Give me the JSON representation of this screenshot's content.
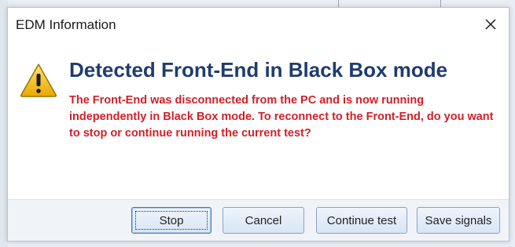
{
  "dialog": {
    "title": "EDM Information",
    "heading": "Detected Front-End in Black Box mode",
    "message": "The Front-End was disconnected from the PC and is now running independently in Black Box mode. To reconnect to the Front-End, do you want to stop or continue running the current test?",
    "close_symbol": "✕"
  },
  "buttons": {
    "stop": "Stop",
    "cancel": "Cancel",
    "continue": "Continue test",
    "save": "Save signals"
  },
  "colors": {
    "heading": "#203c6e",
    "message": "#d21f27",
    "warning_fill": "#f5c400"
  },
  "icons": {
    "warning": "warning-icon",
    "close": "close-icon"
  }
}
